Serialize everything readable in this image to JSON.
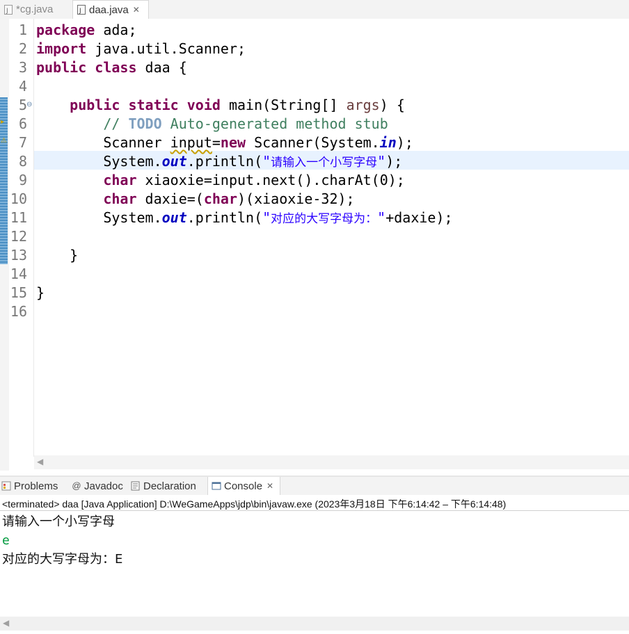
{
  "editor_tabs": [
    {
      "label": "*cg.java",
      "active": false
    },
    {
      "label": "daa.java",
      "active": true,
      "close": "✕"
    }
  ],
  "line_numbers": [
    "1",
    "2",
    "3",
    "4",
    "5",
    "6",
    "7",
    "8",
    "9",
    "10",
    "11",
    "12",
    "13",
    "14",
    "15",
    "16"
  ],
  "code": {
    "l1": {
      "kw": "package",
      "rest": " ada;"
    },
    "l2": {
      "kw": "import",
      "rest": " java.util.Scanner;"
    },
    "l3": {
      "kw1": "public",
      "kw2": "class",
      "rest": " daa {"
    },
    "l5": {
      "indent": "    ",
      "kw1": "public",
      "kw2": "static",
      "kw3": "void",
      "rest1": " main(String[] ",
      "arg": "args",
      "rest2": ") {"
    },
    "l6": {
      "indent": "        ",
      "c1": "// ",
      "todo": "TODO",
      "c2": " Auto-generated method stub"
    },
    "l7": {
      "indent": "        ",
      "t1": "Scanner ",
      "var": "input",
      "t2": "=",
      "kw": "new",
      "t3": " Scanner(System.",
      "fld": "in",
      "t4": ");"
    },
    "l8": {
      "indent": "        ",
      "t1": "System.",
      "fld": "out",
      "t2": ".println(",
      "q1": "\"",
      "str": "请输入一个小写字母",
      "q2": "\"",
      "t3": ");"
    },
    "l9": {
      "indent": "        ",
      "kw": "char",
      "t1": " xiaoxie=input.next().charAt(0);"
    },
    "l10": {
      "indent": "        ",
      "kw1": "char",
      "t1": " daxie=(",
      "kw2": "char",
      "t2": ")(xiaoxie-32);"
    },
    "l11": {
      "indent": "        ",
      "t1": "System.",
      "fld": "out",
      "t2": ".println(",
      "q1": "\"",
      "str": "对应的大写字母为：",
      "q2": "\"",
      "t3": "+daxie);"
    },
    "l13": {
      "text": "    }"
    },
    "l15": {
      "text": "}"
    }
  },
  "view_tabs": [
    {
      "label": "Problems",
      "icon": "problems-icon"
    },
    {
      "label": "Javadoc",
      "icon": "javadoc-icon"
    },
    {
      "label": "Declaration",
      "icon": "declaration-icon"
    },
    {
      "label": "Console",
      "icon": "console-icon",
      "active": true,
      "close": "✕"
    }
  ],
  "console": {
    "header": "<terminated> daa [Java Application] D:\\WeGameApps\\jdp\\bin\\javaw.exe  (2023年3月18日 下午6:14:42 – 下午6:14:48)",
    "output_line1": "请输入一个小写字母",
    "input_line": "e",
    "output_line2": "对应的大写字母为：E"
  },
  "colors": {
    "keyword": "#7f0055",
    "comment": "#3f7f5f",
    "string": "#2a00ff",
    "field": "#0000c0",
    "console_input": "#009a3e",
    "current_line": "#e8f2fe"
  }
}
